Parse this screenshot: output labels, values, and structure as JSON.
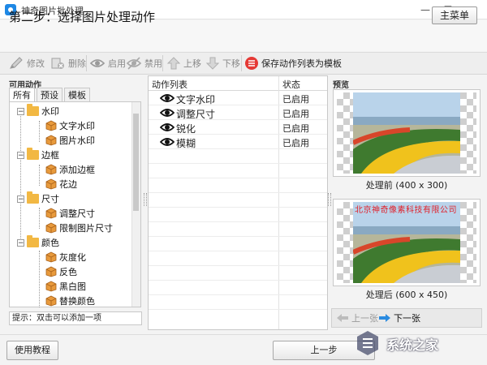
{
  "window": {
    "title": "神奇图片批处理",
    "min_glyph": "—",
    "max_glyph": "☐",
    "close_glyph": "✕"
  },
  "step": {
    "title": "第二步：选择图片处理动作",
    "main_menu": "主菜单"
  },
  "toolbar": {
    "edit": "修改",
    "delete": "删除",
    "enable": "启用",
    "disable": "禁用",
    "up": "上移",
    "down": "下移",
    "save_template": "保存动作列表为模板"
  },
  "left": {
    "heading": "可用动作",
    "tabs": [
      "所有",
      "预设",
      "模板"
    ],
    "tree": [
      {
        "label": "水印",
        "children": [
          "文字水印",
          "图片水印"
        ]
      },
      {
        "label": "边框",
        "children": [
          "添加边框",
          "花边"
        ]
      },
      {
        "label": "尺寸",
        "children": [
          "调整尺寸",
          "限制图片尺寸"
        ]
      },
      {
        "label": "颜色",
        "children": [
          "灰度化",
          "反色",
          "黑白图",
          "替换颜色"
        ]
      }
    ],
    "hint": "提示：双击可以添加一项"
  },
  "middle": {
    "col_action": "动作列表",
    "col_status": "状态",
    "rows": [
      {
        "name": "文字水印",
        "status": "已启用"
      },
      {
        "name": "调整尺寸",
        "status": "已启用"
      },
      {
        "name": "锐化",
        "status": "已启用"
      },
      {
        "name": "模糊",
        "status": "已启用"
      }
    ]
  },
  "preview": {
    "heading": "预览",
    "before_caption": "处理前 (400 x 300)",
    "after_caption": "处理后 (600 x 450)",
    "watermark_text": "北京神奇像素科技有限公司",
    "prev": "上一张",
    "next": "下一张"
  },
  "bottom": {
    "tutorial": "使用教程",
    "prev_step": "上一步"
  },
  "site_watermark": "系统之家",
  "colors": {
    "accent": "#1e88e5",
    "watermark_red": "#e0202a",
    "folder": "#f2b843",
    "save_icon": "#e53935"
  }
}
